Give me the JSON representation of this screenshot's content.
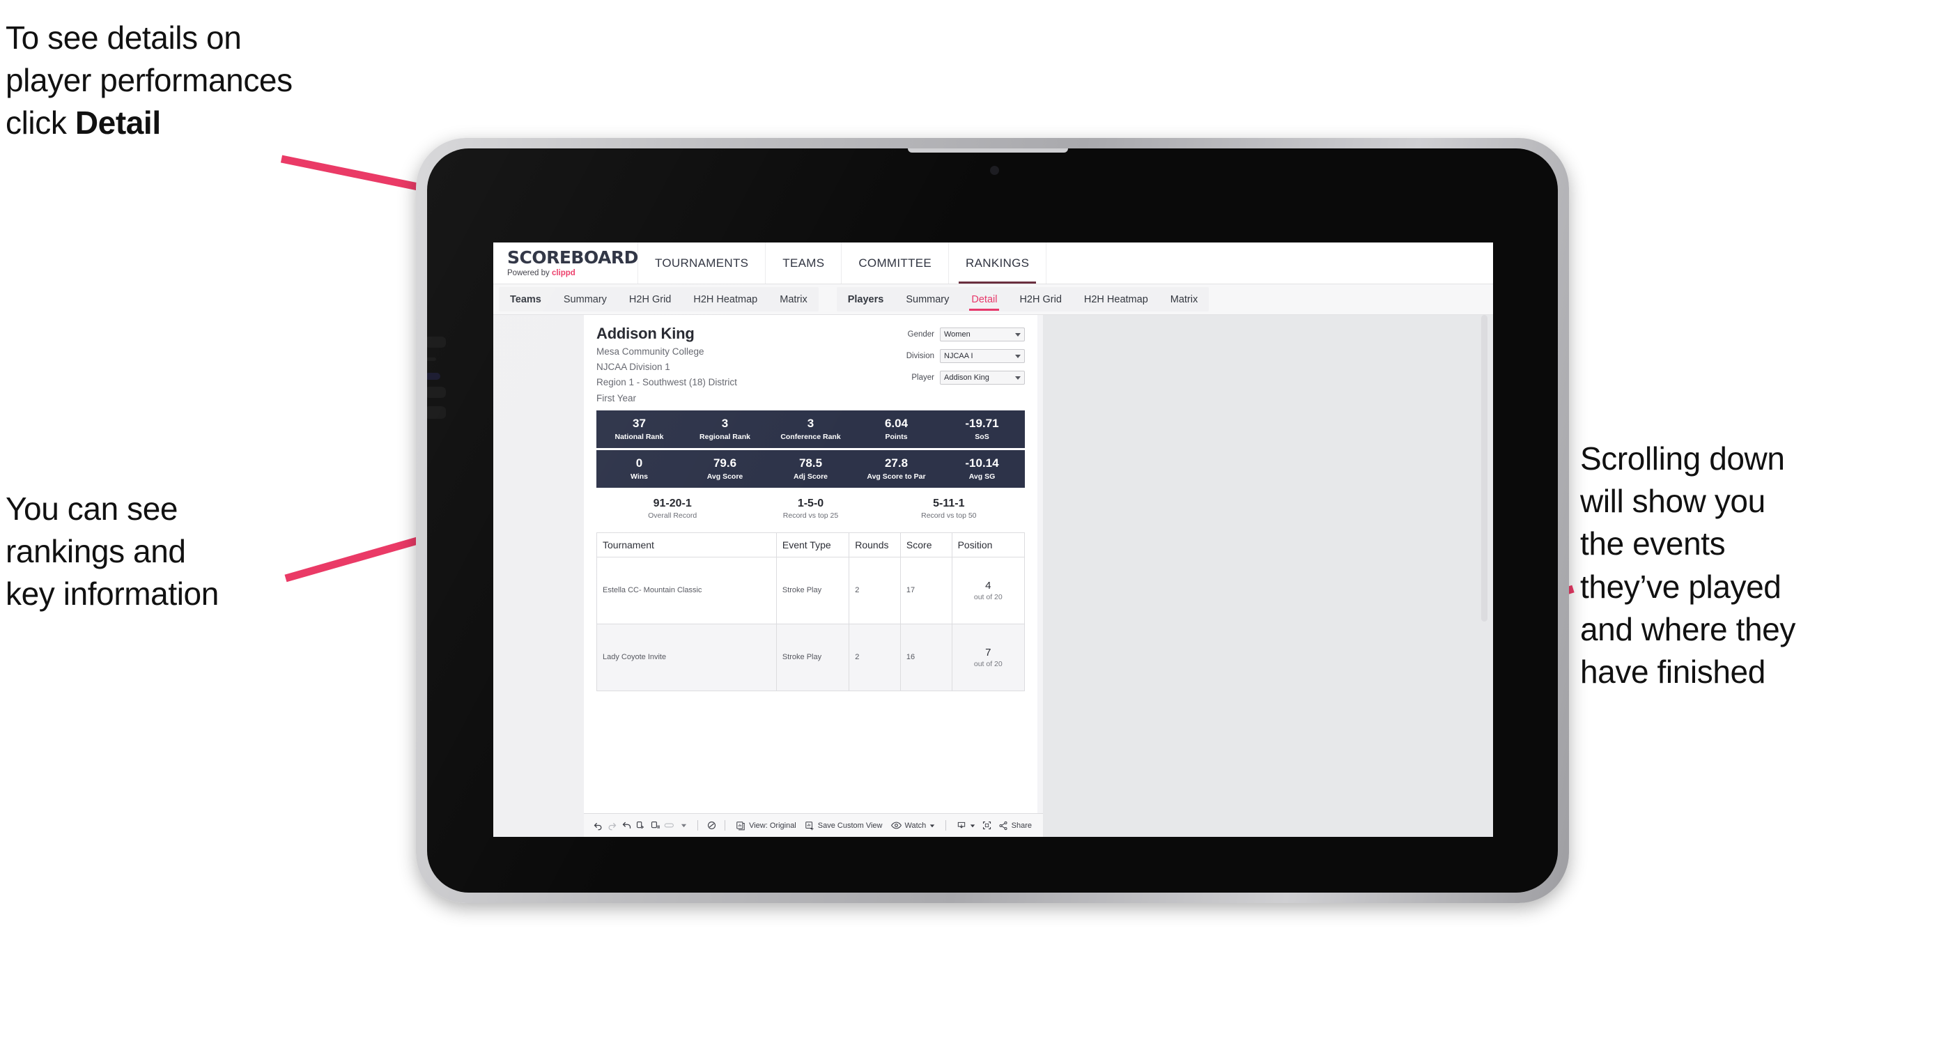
{
  "annotations": {
    "top_left": "To see details on\nplayer performances\nclick ",
    "top_left_bold": "Detail",
    "bottom_left": "You can see\nrankings and\nkey information",
    "right": "Scrolling down\nwill show you\nthe events\nthey’ve played\nand where they\nhave finished",
    "arrow_color": "#ea3a66"
  },
  "app": {
    "logo_main": "SCOREBOARD",
    "logo_sub_prefix": "Powered by ",
    "logo_sub_brand": "clippd",
    "top_nav": [
      {
        "label": "TOURNAMENTS",
        "active": false
      },
      {
        "label": "TEAMS",
        "active": false
      },
      {
        "label": "COMMITTEE",
        "active": false
      },
      {
        "label": "RANKINGS",
        "active": true
      }
    ],
    "tab_groups": [
      {
        "head": "Teams",
        "tabs": [
          {
            "label": "Summary",
            "active": false
          },
          {
            "label": "H2H Grid",
            "active": false
          },
          {
            "label": "H2H Heatmap",
            "active": false
          },
          {
            "label": "Matrix",
            "active": false
          }
        ]
      },
      {
        "head": "Players",
        "tabs": [
          {
            "label": "Summary",
            "active": false
          },
          {
            "label": "Detail",
            "active": true
          },
          {
            "label": "H2H Grid",
            "active": false
          },
          {
            "label": "H2H Heatmap",
            "active": false
          },
          {
            "label": "Matrix",
            "active": false
          }
        ]
      }
    ]
  },
  "player": {
    "name": "Addison King",
    "school": "Mesa Community College",
    "division": "NJCAA Division 1",
    "region": "Region 1 - Southwest (18) District",
    "year": "First Year"
  },
  "filters": [
    {
      "label": "Gender",
      "value": "Women"
    },
    {
      "label": "Division",
      "value": "NJCAA I"
    },
    {
      "label": "Player",
      "value": "Addison King"
    }
  ],
  "stat_rows": [
    [
      {
        "value": "37",
        "label": "National Rank"
      },
      {
        "value": "3",
        "label": "Regional Rank"
      },
      {
        "value": "3",
        "label": "Conference Rank"
      },
      {
        "value": "6.04",
        "label": "Points"
      },
      {
        "value": "-19.71",
        "label": "SoS"
      }
    ],
    [
      {
        "value": "0",
        "label": "Wins"
      },
      {
        "value": "79.6",
        "label": "Avg Score"
      },
      {
        "value": "78.5",
        "label": "Adj Score"
      },
      {
        "value": "27.8",
        "label": "Avg Score to Par"
      },
      {
        "value": "-10.14",
        "label": "Avg SG"
      }
    ]
  ],
  "records": [
    {
      "value": "91-20-1",
      "label": "Overall Record"
    },
    {
      "value": "1-5-0",
      "label": "Record vs top 25"
    },
    {
      "value": "5-11-1",
      "label": "Record vs top 50"
    }
  ],
  "table": {
    "headers": [
      "Tournament",
      "Event Type",
      "Rounds",
      "Score",
      "Position"
    ],
    "rows": [
      {
        "tournament": "Estella CC- Mountain Classic",
        "event_type": "Stroke Play",
        "rounds": "2",
        "score": "17",
        "position_value": "4",
        "position_label": "out of 20"
      },
      {
        "tournament": "Lady Coyote Invite",
        "event_type": "Stroke Play",
        "rounds": "2",
        "score": "16",
        "position_value": "7",
        "position_label": "out of 20"
      }
    ]
  },
  "toolbar": {
    "view_label": "View: Original",
    "save_label": "Save Custom View",
    "watch_label": "Watch",
    "share_label": "Share"
  }
}
